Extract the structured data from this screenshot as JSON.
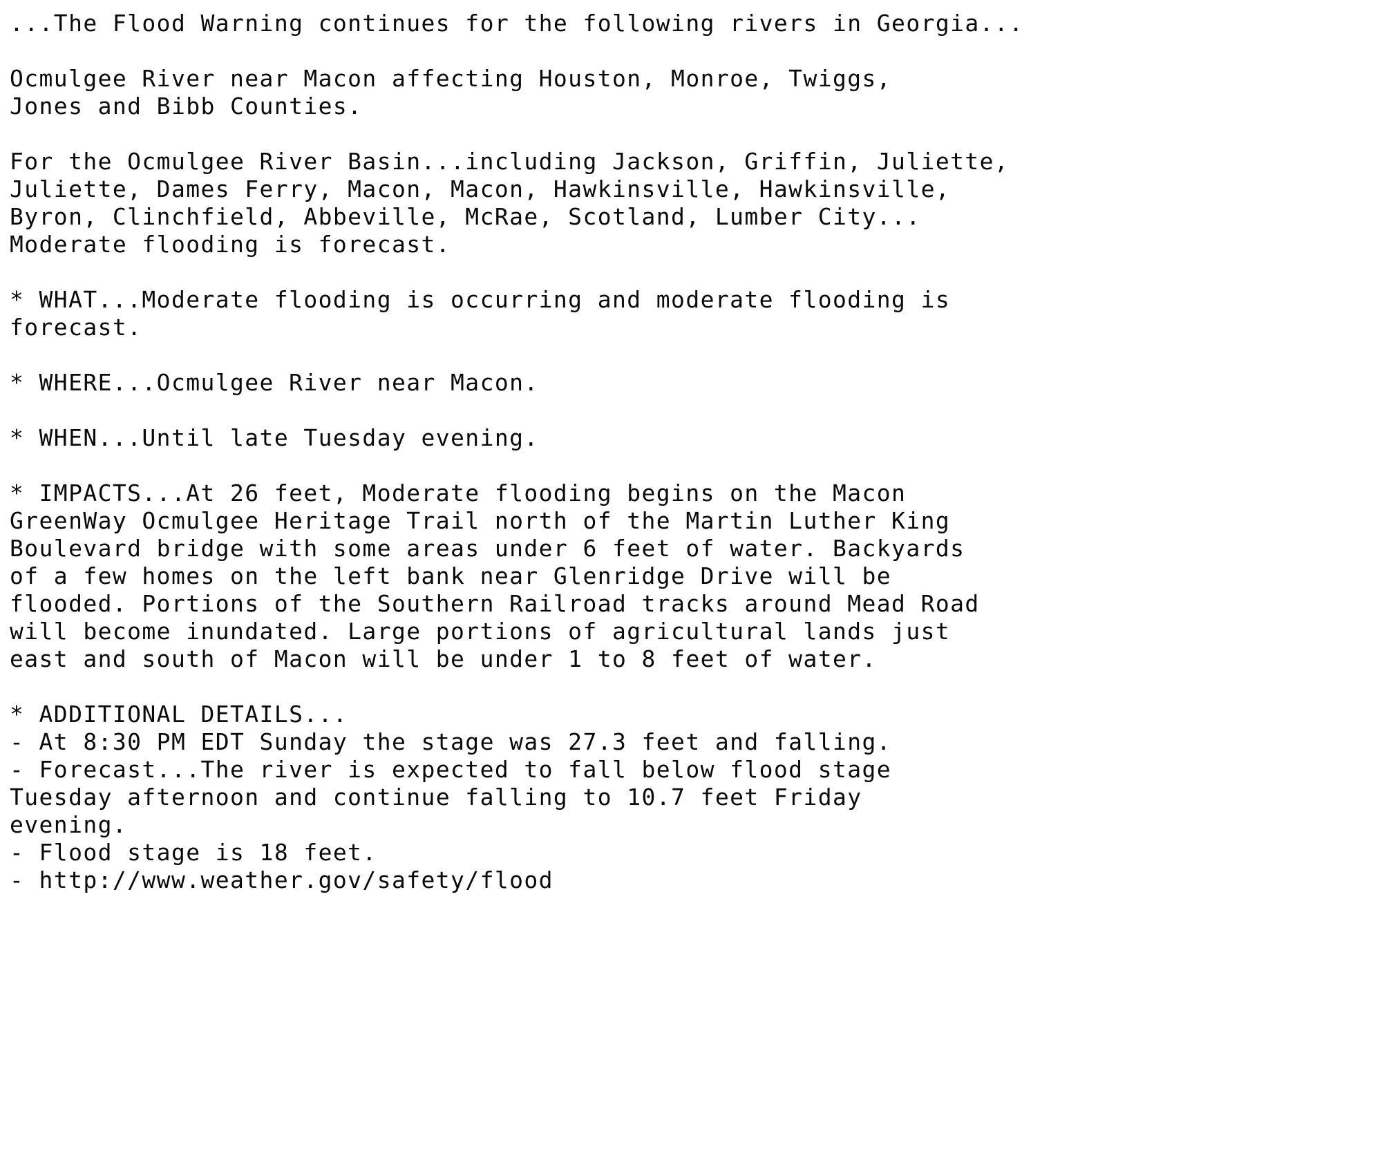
{
  "document": {
    "kind": "nws-text-bulletin",
    "background_color": "#ffffff",
    "text_color": "#000000",
    "headline": "...The Flood Warning continues for the following rivers in Georgia...",
    "lines": [
      "...The Flood Warning continues for the following rivers in Georgia...",
      "",
      "Ocmulgee River near Macon affecting Houston, Monroe, Twiggs,",
      "Jones and Bibb Counties.",
      "",
      "For the Ocmulgee River Basin...including Jackson, Griffin, Juliette,",
      "Juliette, Dames Ferry, Macon, Macon, Hawkinsville, Hawkinsville,",
      "Byron, Clinchfield, Abbeville, McRae, Scotland, Lumber City...",
      "Moderate flooding is forecast.",
      "",
      "* WHAT...Moderate flooding is occurring and moderate flooding is",
      "forecast.",
      "",
      "* WHERE...Ocmulgee River near Macon.",
      "",
      "* WHEN...Until late Tuesday evening.",
      "",
      "* IMPACTS...At 26 feet, Moderate flooding begins on the Macon",
      "GreenWay Ocmulgee Heritage Trail north of the Martin Luther King",
      "Boulevard bridge with some areas under 6 feet of water. Backyards",
      "of a few homes on the left bank near Glenridge Drive will be",
      "flooded. Portions of the Southern Railroad tracks around Mead Road",
      "will become inundated. Large portions of agricultural lands just",
      "east and south of Macon will be under 1 to 8 feet of water.",
      "",
      "* ADDITIONAL DETAILS...",
      "- At 8:30 PM EDT Sunday the stage was 27.3 feet and falling.",
      "- Forecast...The river is expected to fall below flood stage",
      "Tuesday afternoon and continue falling to 10.7 feet Friday",
      "evening.",
      "- Flood stage is 18 feet.",
      "- http://www.weather.gov/safety/flood"
    ],
    "sections": {
      "river": "Ocmulgee River near Macon",
      "affected_counties": "Houston, Monroe, Twiggs, Jones and Bibb Counties",
      "basin": "Ocmulgee River Basin",
      "basin_locations": "Jackson, Griffin, Juliette, Juliette, Dames Ferry, Macon, Macon, Hawkinsville, Hawkinsville, Byron, Clinchfield, Abbeville, McRae, Scotland, Lumber City",
      "basin_summary": "Moderate flooding is forecast.",
      "what": "Moderate flooding is occurring and moderate flooding is forecast.",
      "where": "Ocmulgee River near Macon.",
      "when": "Until late Tuesday evening.",
      "impacts": "At 26 feet, Moderate flooding begins on the Macon GreenWay Ocmulgee Heritage Trail north of the Martin Luther King Boulevard bridge with some areas under 6 feet of water. Backyards of a few homes on the left bank near Glenridge Drive will be flooded. Portions of the Southern Railroad tracks around Mead Road will become inundated. Large portions of agricultural lands just east and south of Macon will be under 1 to 8 feet of water.",
      "additional_details": [
        "At 8:30 PM EDT Sunday the stage was 27.3 feet and falling.",
        "Forecast...The river is expected to fall below flood stage Tuesday afternoon and continue falling to 10.7 feet Friday evening.",
        "Flood stage is 18 feet.",
        "http://www.weather.gov/safety/flood"
      ]
    },
    "values": {
      "impact_stage_feet": "26",
      "observation_time": "8:30 PM EDT Sunday",
      "observed_stage_feet": "27.3",
      "observed_trend": "falling",
      "forecast_crest_fall_feet": "10.7",
      "forecast_fall_day": "Friday evening",
      "flood_stage_feet": "18",
      "depth_under_bridge_feet": "6",
      "agricultural_depth_feet": "1 to 8",
      "safety_url": "http://www.weather.gov/safety/flood"
    }
  }
}
